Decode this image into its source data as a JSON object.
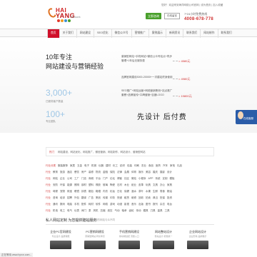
{
  "header": {
    "logo": {
      "line1": "HAI",
      "line2": "YANG",
      "sub": "Network",
      "dot_colors": [
        "#e23a2a",
        "#f29b1f",
        "#3a8fd0",
        "#4aa02c"
      ]
    },
    "top_note": "您好！欢迎来到海洋网络公司官网 | 设为首页 | 加入收藏",
    "start_button": "立即咨询",
    "online_button": "在线留言",
    "phone_label": "7*24小时免费热线",
    "phone": "4008-678-778"
  },
  "nav": {
    "items": [
      "首页",
      "关于我们",
      "网站建设",
      "SEO优化",
      "微信公众号",
      "营销推广",
      "案例展示",
      "新闻资讯",
      "联系我们",
      "网站制作",
      "联系我们"
    ]
  },
  "banner": {
    "headline1": "10年专注",
    "headline2": "网站建设与营销经验",
    "stat1_value": "3,000+",
    "stat1_label": "已服务客户数量",
    "stat2_value": "100+",
    "stat2_label": "专业团队",
    "slogan": "先设计 后付费",
    "packages": [
      {
        "text": "营销型网站+手机网站+微信公众号站点+同步管理+1年后无服务费",
        "price": "= 4580元"
      },
      {
        "text": "品牌官网建设3000-20000+一次建站终身使用",
        "price": "= 4980元"
      },
      {
        "text": "SEO推广+网站运营+网络营销策划+站点推广套餐+品牌宣传+口碑营销+百度LOGO",
        "price": "= 19800元"
      }
    ],
    "avatar_label": "在线客服"
  },
  "hot_search": {
    "label": "热门",
    "text": "网站建设、网站优化、网站推广、微信营销、网站制作、网站设计、营销型网站"
  },
  "grid_rows": [
    [
      "行业分类",
      "服装服饰",
      "家居",
      "五金",
      "电子",
      "机械",
      "仪器",
      "建材",
      "化工",
      "纺织",
      "包装",
      "印刷",
      "农业",
      "食品",
      "医药",
      "汽车",
      "家电",
      "礼品"
    ],
    [
      "行业",
      "教育",
      "旅游",
      "酒店",
      "餐饮",
      "房产",
      "装修",
      "物流",
      "金融",
      "保险",
      "法律",
      "会展",
      "体育",
      "娱乐",
      "美容",
      "婚庆",
      "摄影",
      "设计"
    ],
    [
      "行业",
      "网站",
      "企业",
      "公司",
      "工厂",
      "门店",
      "商城",
      "平台",
      "门户",
      "论坛",
      "博客",
      "社区",
      "微站",
      "小程序",
      "APP",
      "系统",
      "定制",
      "模板"
    ],
    [
      "行业",
      "安防",
      "环保",
      "能源",
      "照明",
      "钢材",
      "塑料",
      "橡胶",
      "玻璃",
      "陶瓷",
      "石材",
      "木业",
      "纸业",
      "皮革",
      "玩具",
      "文具",
      "办公",
      "家具"
    ],
    [
      "行业",
      "母婴",
      "宠物",
      "珠宝",
      "眼镜",
      "钟表",
      "箱包",
      "鞋帽",
      "内衣",
      "化妆",
      "日化",
      "保健",
      "酒水",
      "茶叶",
      "水果",
      "生鲜",
      "零食",
      "粮油"
    ],
    [
      "行业",
      "咨询",
      "培训",
      "招聘",
      "外包",
      "翻译",
      "广告",
      "策划",
      "传媒",
      "印务",
      "快递",
      "租赁",
      "维修",
      "回收",
      "拍卖",
      "典当",
      "担保",
      "投资"
    ],
    [
      "行业",
      "通讯",
      "数码",
      "电脑",
      "手机",
      "配件",
      "耗材",
      "软件",
      "网络",
      "游戏",
      "动漫",
      "影视",
      "音乐",
      "出版",
      "图书",
      "报刊",
      "杂志",
      "电台"
    ],
    [
      "行业",
      "机电",
      "电工",
      "电气",
      "仪表",
      "阀门",
      "泵",
      "风机",
      "压缩",
      "液压",
      "气动",
      "轴承",
      "齿轮",
      "传动",
      "模具",
      "刀具",
      "量具",
      "工具"
    ]
  ],
  "section": {
    "title": "私人网站定制 为您提供建站服务",
    "subtitle": "一站一策定制，让您的网站与众不同"
  },
  "services": [
    {
      "title": "企业PC官网建设",
      "sub": "专业设计 品质保障"
    },
    {
      "title": "PC营销网建设",
      "sub": "营销型网站 转化率高"
    },
    {
      "title": "手机营销网建设",
      "sub": "移动端适配 流量入口"
    },
    {
      "title": "网站整站设计",
      "sub": "整站设计 视觉统一"
    },
    {
      "title": "企业网站设计",
      "sub": "企业形象 品牌展示"
    }
  ],
  "status_bar": "正在等待 www.hyrcn.com..."
}
